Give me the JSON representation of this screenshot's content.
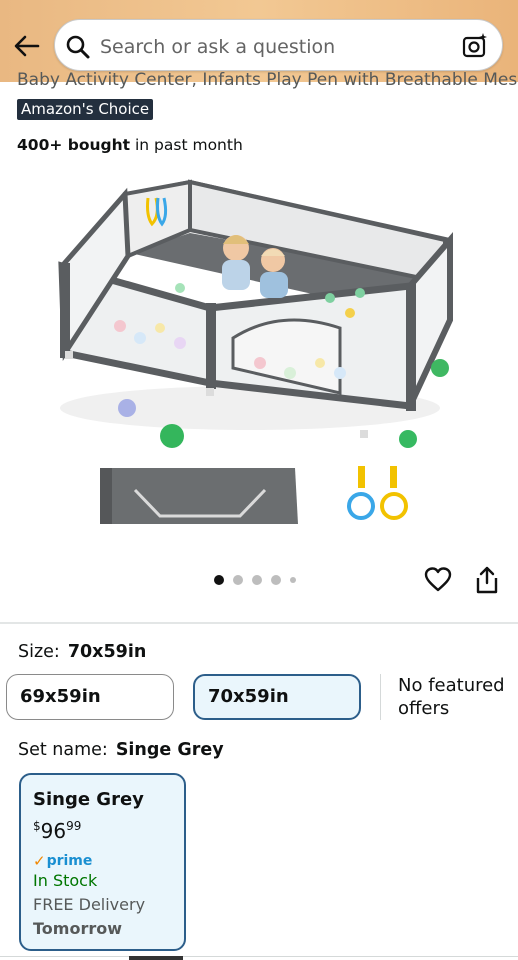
{
  "header": {
    "search_placeholder": "Search or ask a question",
    "back_icon": "back-arrow-icon",
    "search_icon": "search-icon",
    "camera_icon": "camera-search-icon",
    "bg_color": "#f0c28c"
  },
  "product": {
    "cut_title": "Baby Activity Center, Infants Play Pen with Breathable Mesh",
    "badge": "Amazon's Choice",
    "bought_bold": "400+ bought",
    "bought_rest": " in past month",
    "carousel_dots": 5,
    "carousel_active": 0
  },
  "size": {
    "label": "Size:",
    "selected": "70x59in",
    "options": [
      "69x59in",
      "70x59in"
    ],
    "no_offers": "No featured offers"
  },
  "set_name": {
    "label": "Set name:",
    "selected": "Singe Grey",
    "card": {
      "name": "Singe Grey",
      "price_symbol": "$",
      "price_whole": "96",
      "price_fraction": "99",
      "prime": "prime",
      "stock": "In Stock",
      "delivery": "FREE Delivery",
      "delivery_day": "Tomorrow"
    }
  },
  "colors": {
    "accent_border": "#2c5e8a",
    "selected_bg": "#eaf6fc",
    "in_stock": "#007600",
    "prime_blue": "#1a8fd1",
    "prime_check": "#f08804"
  }
}
